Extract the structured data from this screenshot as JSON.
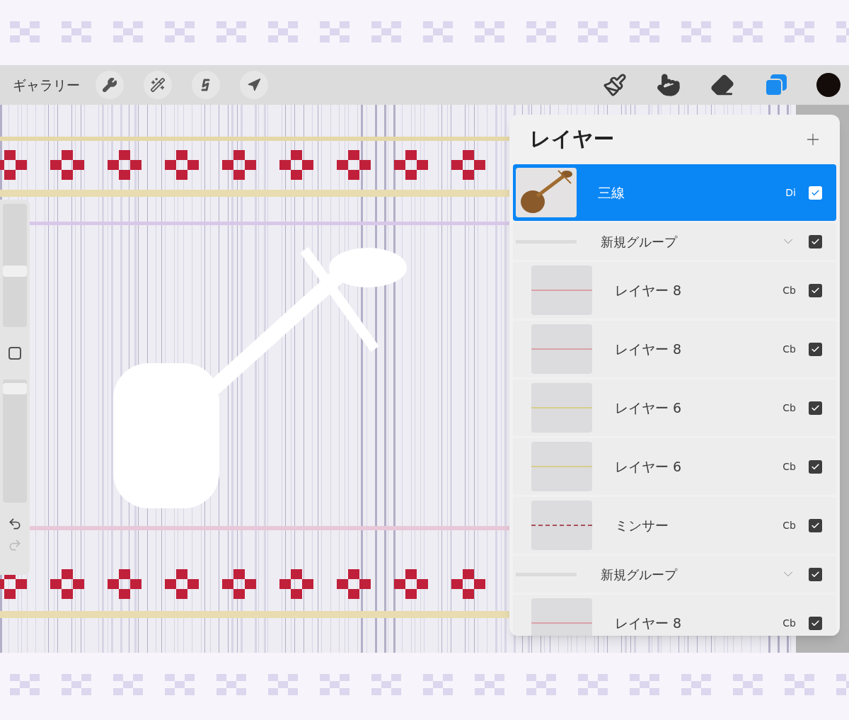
{
  "toolbar": {
    "gallery": "ギャラリー",
    "tools": [
      {
        "kind": "brush",
        "selected": false
      },
      {
        "kind": "smudge",
        "selected": false
      },
      {
        "kind": "eraser",
        "selected": false
      },
      {
        "kind": "layers",
        "selected": true
      }
    ],
    "color_swatch": {
      "color": "#140c08"
    }
  },
  "side_controls": {
    "brush_size": {
      "level": 0.45
    },
    "opacity": {
      "level": 0.97
    }
  },
  "layers_panel": {
    "title": "レイヤー",
    "layers": [
      {
        "kind": "figure",
        "name": "三線",
        "blend": "Di",
        "checked": true,
        "selected": true
      },
      {
        "kind": "group",
        "name": "新規グループ",
        "checked": true,
        "selected": false,
        "expanded": true,
        "children": [
          {
            "kind": "line",
            "name": "レイヤー 8",
            "blend": "Cb",
            "checked": true,
            "selected": false,
            "color": "#d9a3a8"
          },
          {
            "kind": "line",
            "name": "レイヤー 8",
            "blend": "Cb",
            "checked": true,
            "selected": false,
            "color": "#d9a3a8"
          },
          {
            "kind": "line",
            "name": "レイヤー 6",
            "blend": "Cb",
            "checked": true,
            "selected": false,
            "color": "#d6cf8c"
          },
          {
            "kind": "line",
            "name": "レイヤー 6",
            "blend": "Cb",
            "checked": true,
            "selected": false,
            "color": "#d6cf8c"
          },
          {
            "kind": "stitch",
            "name": "ミンサー",
            "blend": "Cb",
            "checked": true,
            "selected": false,
            "color": "#a8505e"
          }
        ]
      },
      {
        "kind": "group",
        "name": "新規グループ",
        "checked": true,
        "selected": false,
        "expanded": true,
        "children": [
          {
            "kind": "line",
            "name": "レイヤー 8",
            "blend": "Cb",
            "checked": true,
            "selected": false,
            "color": "#d9a3a8"
          }
        ]
      }
    ]
  }
}
